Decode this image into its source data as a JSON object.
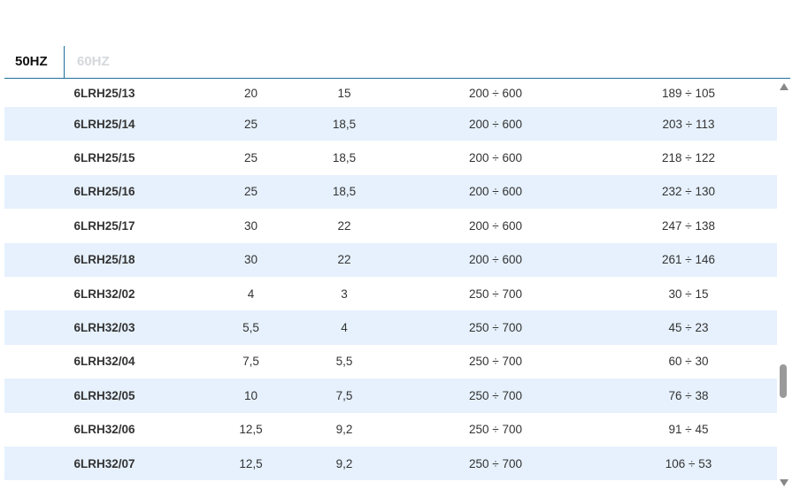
{
  "tabs": [
    {
      "label": "50HZ",
      "active": true
    },
    {
      "label": "60HZ",
      "active": false
    }
  ],
  "table": {
    "rows": [
      [
        "6LRH25/13",
        "20",
        "15",
        "200 ÷ 600",
        "189 ÷ 105"
      ],
      [
        "6LRH25/14",
        "25",
        "18,5",
        "200 ÷ 600",
        "203 ÷ 113"
      ],
      [
        "6LRH25/15",
        "25",
        "18,5",
        "200 ÷ 600",
        "218 ÷ 122"
      ],
      [
        "6LRH25/16",
        "25",
        "18,5",
        "200 ÷ 600",
        "232 ÷ 130"
      ],
      [
        "6LRH25/17",
        "30",
        "22",
        "200 ÷ 600",
        "247 ÷ 138"
      ],
      [
        "6LRH25/18",
        "30",
        "22",
        "200 ÷ 600",
        "261 ÷ 146"
      ],
      [
        "6LRH32/02",
        "4",
        "3",
        "250 ÷ 700",
        "30 ÷ 15"
      ],
      [
        "6LRH32/03",
        "5,5",
        "4",
        "250 ÷ 700",
        "45 ÷ 23"
      ],
      [
        "6LRH32/04",
        "7,5",
        "5,5",
        "250 ÷ 700",
        "60 ÷ 30"
      ],
      [
        "6LRH32/05",
        "10",
        "7,5",
        "250 ÷ 700",
        "76 ÷ 38"
      ],
      [
        "6LRH32/06",
        "12,5",
        "9,2",
        "250 ÷ 700",
        "91 ÷ 45"
      ],
      [
        "6LRH32/07",
        "12,5",
        "9,2",
        "250 ÷ 700",
        "106 ÷ 53"
      ]
    ]
  },
  "scrollbar": {
    "up_icon": "triangle-up-icon",
    "down_icon": "triangle-down-icon",
    "position": 0.72
  },
  "colors": {
    "accent": "#1f6f9a",
    "row_stripe": "#e6f1fd",
    "inactive_tab": "#d4d8dc"
  }
}
